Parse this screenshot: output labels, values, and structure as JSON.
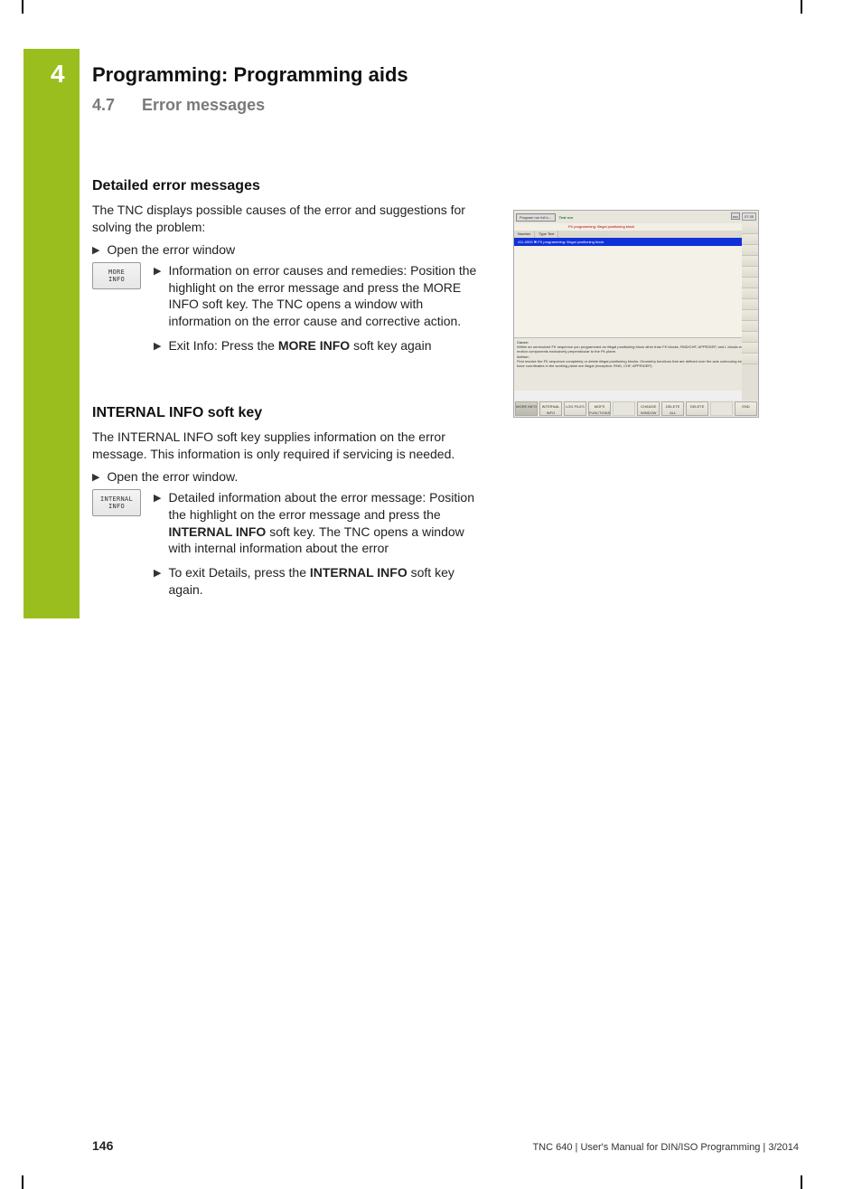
{
  "chapter": {
    "number": "4",
    "title": "Programming: Programming aids"
  },
  "section": {
    "number": "4.7",
    "title": "Error messages"
  },
  "detailed": {
    "heading": "Detailed error messages",
    "intro": "The TNC displays possible causes of the error and suggestions for solving the problem:",
    "open": "Open the error window",
    "softkey": {
      "line1": "MORE",
      "line2": "INFO"
    },
    "b1": "Information on error causes and remedies: Position the highlight on the error message and press the MORE INFO soft key. The TNC opens a window with information on the error cause and corrective action.",
    "b2_pre": "Exit Info: Press the ",
    "b2_bold": "MORE INFO",
    "b2_post": " soft key again"
  },
  "internal": {
    "heading_bold": "INTERNAL INFO",
    "heading_rest": " soft key",
    "intro": "The INTERNAL INFO soft key supplies information on the error message. This information is only required if servicing is needed.",
    "open": "Open the error window.",
    "softkey": {
      "line1": "INTERNAL",
      "line2": "INFO"
    },
    "b1_pre": "Detailed information about the error message: Position the highlight on the error message and press the ",
    "b1_bold": "INTERNAL INFO",
    "b1_post": " soft key. The TNC opens a window with internal information about the error",
    "b2_pre": "To exit Details, press the ",
    "b2_bold": "INTERNAL INFO",
    "b2_post": " soft key again."
  },
  "screenshot": {
    "mode": "Program run full s…",
    "title": "Test run",
    "subtitle": "FK programming: Illegal positioning block",
    "dnc": "DNC",
    "time": "07:35",
    "col1": "Number",
    "col2": "Type Text",
    "bluebar": "411-0009   ✖ FK programming: Illegal positioning block",
    "cause_hd": "Cause:",
    "cause": "Within an unresolved FK sequence you programmed an illegal positioning block other than FK blocks, RND/CHF, APPR/DEP, and L blocks with motion components exclusively perpendicular to the FK plane.",
    "action_hd": "Action:",
    "action": "First resolve the FK sequence completely or delete illegal positioning blocks. Geometry functions that are defined over the axis contouring keys and have coordinates in the working plane are illegal (exception: RND, CHF, APPR/DEP).",
    "keys": [
      "MORE INFO",
      "INTERNAL INFO",
      "LOG FILES",
      "MOFS FUNCTIONS",
      "",
      "CHANGE WINDOW",
      "DELETE ALL",
      "DELETE",
      "",
      "END"
    ]
  },
  "footer": {
    "page": "146",
    "text": "TNC 640 | User's Manual for DIN/ISO Programming | 3/2014"
  }
}
